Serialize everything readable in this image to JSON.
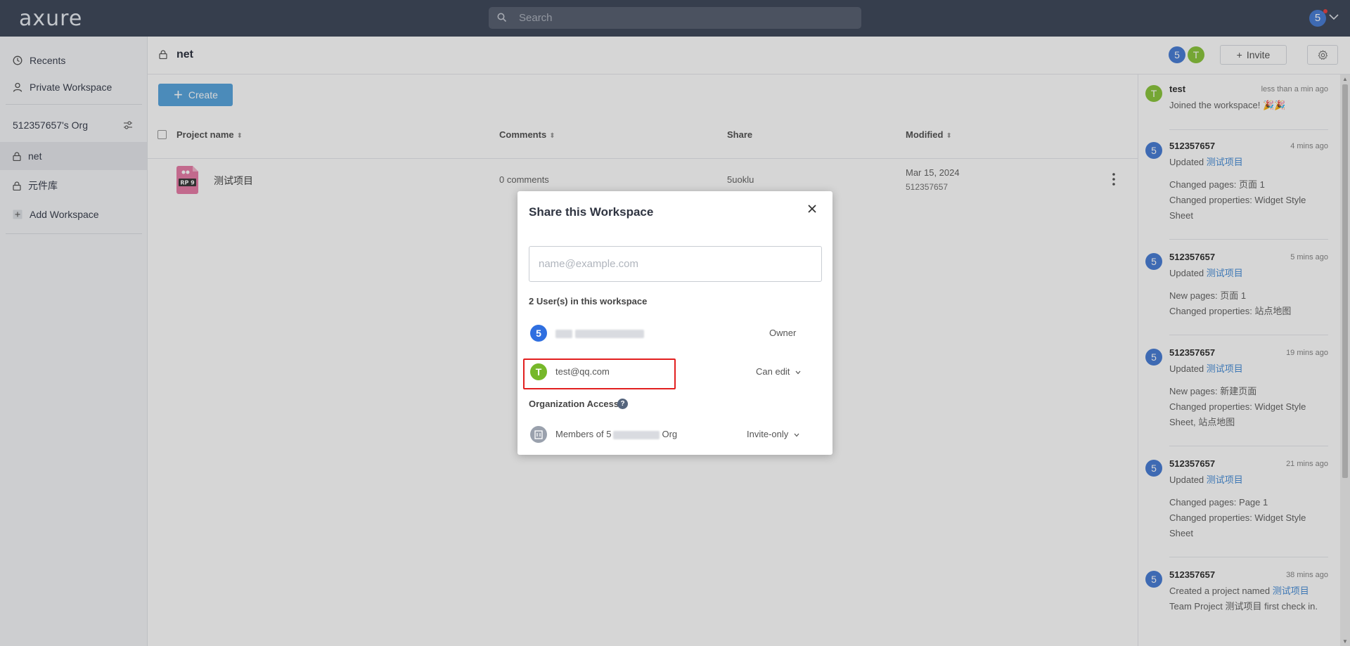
{
  "app": {
    "logo_text": "axure",
    "search_placeholder": "Search",
    "user_initial": "5"
  },
  "sidebar": {
    "recents": "Recents",
    "private_workspace": "Private Workspace",
    "org_name": "512357657's Org",
    "workspaces": [
      {
        "label": "net",
        "active": true
      },
      {
        "label": "元件库",
        "active": false
      }
    ],
    "add_workspace": "Add Workspace"
  },
  "header": {
    "workspace_title": "net",
    "member_initials": [
      "5",
      "T"
    ],
    "invite_label": "Invite",
    "create_label": "Create"
  },
  "table": {
    "columns": {
      "project_name": "Project name",
      "comments": "Comments",
      "share": "Share",
      "modified": "Modified"
    },
    "rows": [
      {
        "icon_text": "RP 9",
        "name": "测试项目",
        "comments": "0 comments",
        "share": "5uoklu",
        "modified_date": "Mar 15, 2024",
        "modified_by": "512357657"
      }
    ]
  },
  "activity": [
    {
      "initial": "T",
      "user": "test",
      "time": "less than a min ago",
      "line1": "Joined the workspace! 🎉🎉",
      "link": "",
      "details": []
    },
    {
      "initial": "5",
      "user": "512357657",
      "time": "4 mins ago",
      "line1": "Updated ",
      "link": "测试项目",
      "details": [
        "Changed pages: 页面 1",
        "Changed properties: Widget Style Sheet"
      ]
    },
    {
      "initial": "5",
      "user": "512357657",
      "time": "5 mins ago",
      "line1": "Updated ",
      "link": "测试项目",
      "details": [
        "New pages: 页面 1",
        "Changed properties: 站点地图"
      ]
    },
    {
      "initial": "5",
      "user": "512357657",
      "time": "19 mins ago",
      "line1": "Updated ",
      "link": "测试项目",
      "details": [
        "New pages: 新建页面",
        "Changed properties: Widget Style Sheet, 站点地图"
      ]
    },
    {
      "initial": "5",
      "user": "512357657",
      "time": "21 mins ago",
      "line1": "Updated ",
      "link": "测试项目",
      "details": [
        "Changed pages: Page 1",
        "Changed properties: Widget Style Sheet"
      ]
    },
    {
      "initial": "5",
      "user": "512357657",
      "time": "38 mins ago",
      "line1": "Created a project named ",
      "link": "测试项目",
      "details": [
        "Team Project 测试项目 first check in."
      ]
    }
  ],
  "modal": {
    "title": "Share this Workspace",
    "email_placeholder": "name@example.com",
    "users_count": "2 User(s) in this workspace",
    "owner": {
      "initial": "5",
      "name_visible": "5",
      "role": "Owner"
    },
    "member": {
      "initial": "T",
      "email": "test@qq.com",
      "role": "Can edit"
    },
    "org_access_label": "Organization Access",
    "org_members_prefix": "Members of 5",
    "org_members_suffix": "Org",
    "org_access_value": "Invite-only"
  },
  "colors": {
    "topbar": "#414a5c",
    "avatar_blue": "#4a7fd6",
    "avatar_green": "#8cc63f",
    "owner_blue": "#2f6fe0",
    "member_green": "#76b82a",
    "accent": "#5aa6de",
    "highlight": "#e21f1f"
  }
}
